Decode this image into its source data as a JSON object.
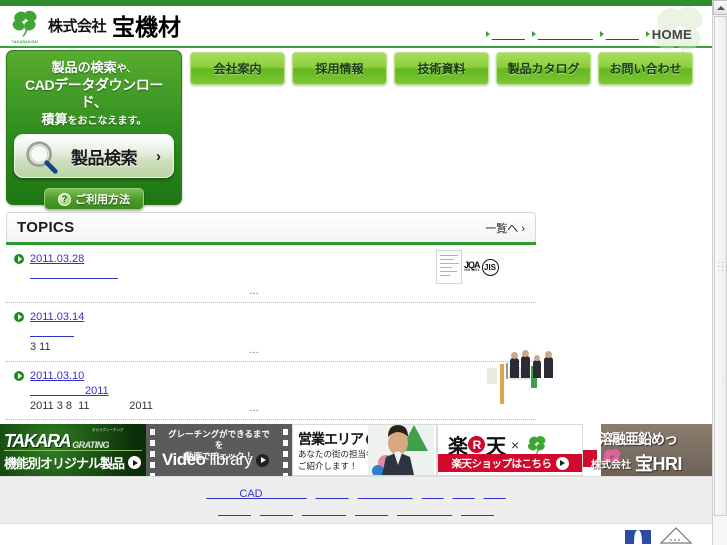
{
  "header": {
    "company_prefix": "株式会社",
    "company_name": "宝機材",
    "logo_romaji": "TAKARAKIZAI",
    "util_links": [
      "＿＿＿",
      "＿＿＿＿＿",
      "＿＿＿"
    ],
    "home_label": "HOME"
  },
  "gnav": {
    "items": [
      {
        "label": "会社案内"
      },
      {
        "label": "採用情報"
      },
      {
        "label": "技術資料"
      },
      {
        "label": "製品カタログ"
      },
      {
        "label": "お問い合わせ"
      }
    ]
  },
  "search_panel": {
    "lead_line1_strong": "製品の検索",
    "lead_line1_small": "や、",
    "lead_line2": "CADデータダウンロード、",
    "lead_line3_strong": "積算",
    "lead_line3_small": "をおこなえます。",
    "search_button_label": "製品検索",
    "search_button_chevron": "›",
    "help_badge": "?",
    "help_button_label": "ご利用方法"
  },
  "topics": {
    "title": "TOPICS",
    "more_label": "一覧へ ›",
    "ellipsis": "…",
    "items": [
      {
        "date": "2011.03.28",
        "title": "＿＿＿＿＿＿＿＿",
        "body": "",
        "thumb": "certificate-thumbnail",
        "thumb_jqa": "JQA",
        "thumb_jqa_sub": "ISO 9001",
        "thumb_jis": "JIS"
      },
      {
        "date": "2011.03.14",
        "title": "＿＿＿＿",
        "body": "3 11",
        "thumb": ""
      },
      {
        "date": "2011.03.10",
        "title": "＿＿＿＿＿2011",
        "body": "2011 3 8  11             2011",
        "thumb": "exhibition-photo-thumbnail"
      }
    ]
  },
  "banners": [
    {
      "name": "takara-grating",
      "brand": "TAKARA",
      "brand_sub": "GRATING",
      "brand_tiny": "タカラグレーチング",
      "label": "機能別オリジナル製品"
    },
    {
      "name": "video-library",
      "caption_line1": "グレーチングができるまでを",
      "caption_line2": "動画でチェック！",
      "title_bold": "Video",
      "title_light": "library"
    },
    {
      "name": "sales-area",
      "title": "営業エリア",
      "sub_line1": "あなたの街の担当者を",
      "sub_line2": "ご紹介します！"
    },
    {
      "name": "rakuten-shop",
      "logo_left": "楽",
      "logo_r": "R",
      "logo_right": "天",
      "times": "×",
      "bar_label": "楽天ショップはこちら"
    },
    {
      "name": "takara-hri",
      "title": "溶融亜鉛めっ",
      "company_prefix": "株式会社",
      "company_name": "宝HRI"
    }
  ],
  "footer": {
    "row1": [
      "＿＿＿CAD＿＿＿＿",
      "＿＿＿",
      "＿＿＿＿＿",
      "＿＿",
      "＿＿",
      "＿＿"
    ],
    "row2": [
      "＿＿＿",
      "＿＿＿",
      "＿＿＿＿",
      "＿＿＿",
      "＿＿＿＿＿",
      "＿＿＿"
    ]
  },
  "scrollbar": {
    "up_arrow": "▲"
  }
}
